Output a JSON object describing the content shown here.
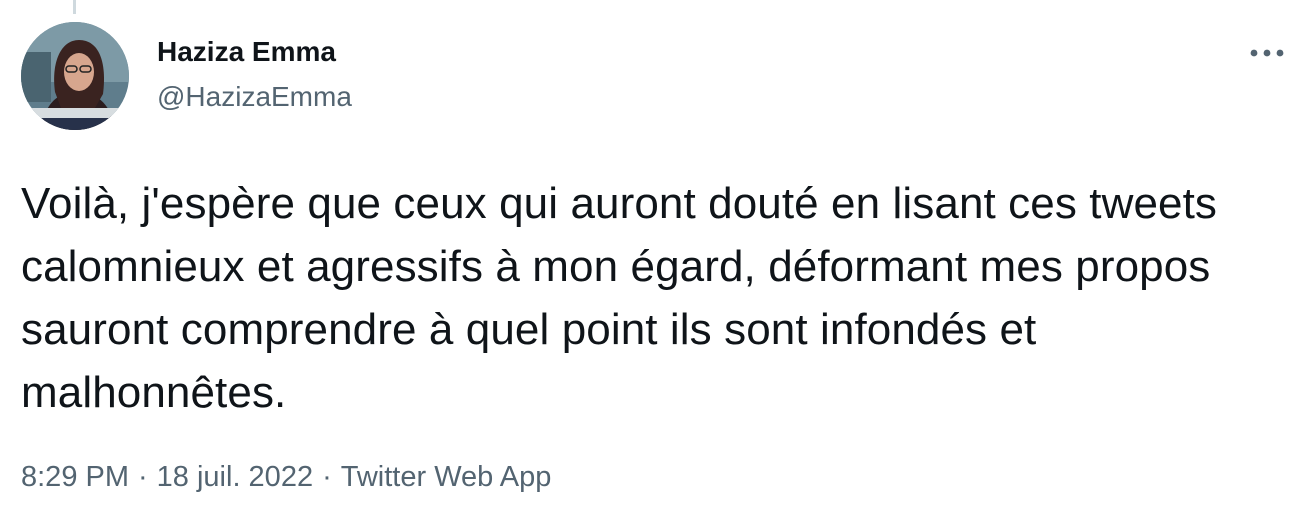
{
  "tweet": {
    "author": {
      "display_name": "Haziza Emma",
      "handle": "@HazizaEmma",
      "avatar_icon": "profile-photo"
    },
    "more_icon": "more-horizontal-icon",
    "text": "Voilà, j'espère que ceux qui auront douté en lisant ces tweets calomnieux et agressifs à mon égard, déformant mes propos sauront comprendre à quel point ils sont infondés et malhonnêtes.",
    "time": "8:29 PM",
    "separator": "·",
    "date": "18 juil. 2022",
    "source": "Twitter Web App"
  },
  "colors": {
    "text": "#0f1419",
    "secondary": "#536471",
    "thread_line": "#cfd9de"
  }
}
